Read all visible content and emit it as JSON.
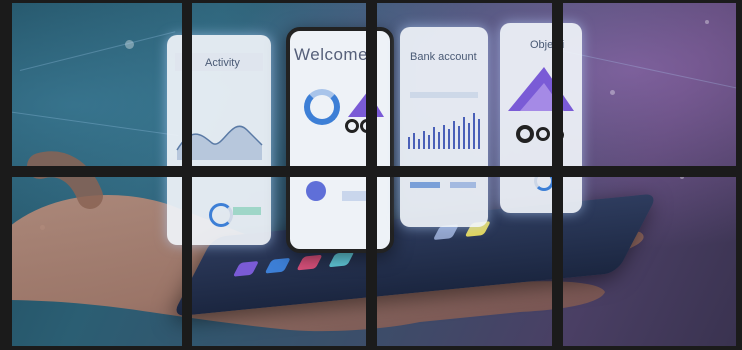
{
  "image": {
    "description_tags": [
      "hand",
      "tablet",
      "holographic app screens",
      "window grid"
    ],
    "colors": {
      "background_teal": "#2b5e73",
      "background_purple": "#4a3f64",
      "grid": "#1b1b1b",
      "card": "#eef2f7",
      "accent_purple": "#7a5bd6",
      "accent_blue": "#3d7fd6"
    }
  },
  "screens": {
    "activity": {
      "title": "Activity"
    },
    "welcome": {
      "title": "Welcome"
    },
    "bank": {
      "title": "Bank account"
    },
    "objective": {
      "title": "Objecti"
    }
  }
}
